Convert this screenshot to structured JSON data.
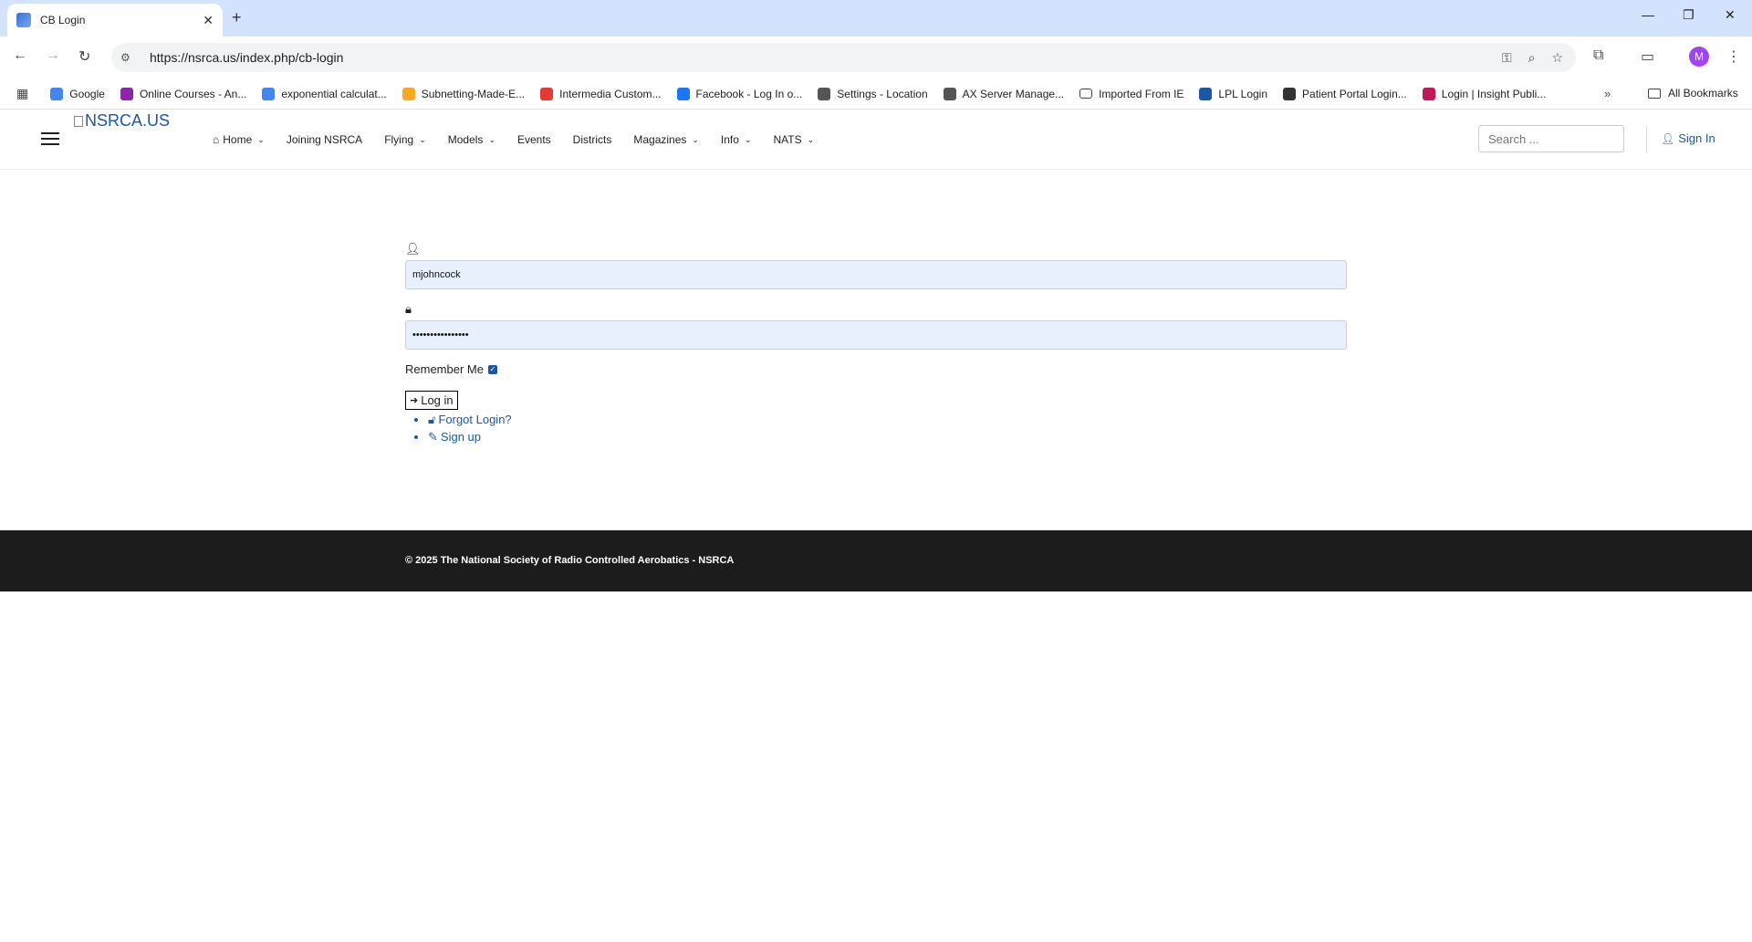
{
  "browser": {
    "tab_title": "CB Login",
    "url": "https://nsrca.us/index.php/cb-login",
    "profile_initial": "M",
    "bookmarks": [
      {
        "label": "Google",
        "color": "#4285f4"
      },
      {
        "label": "Online Courses - An...",
        "color": "#8e24aa"
      },
      {
        "label": "exponential calculat...",
        "color": "#4285f4"
      },
      {
        "label": "Subnetting-Made-E...",
        "color": "#f9a825"
      },
      {
        "label": "Intermedia Custom...",
        "color": "#e53935"
      },
      {
        "label": "Facebook - Log In o...",
        "color": "#1877f2"
      },
      {
        "label": "Settings - Location",
        "color": "#555555"
      },
      {
        "label": "AX Server Manage...",
        "color": "#555555"
      },
      {
        "label": "Imported From IE",
        "color": "#ffffff"
      },
      {
        "label": "LPL Login",
        "color": "#1a58a6"
      },
      {
        "label": "Patient Portal Login...",
        "color": "#333333"
      },
      {
        "label": "Login | Insight Publi...",
        "color": "#c2185b"
      }
    ],
    "all_bookmarks": "All Bookmarks"
  },
  "site": {
    "logo_alt": "NSRCA.US",
    "nav": [
      {
        "label": "Home",
        "has_menu": true,
        "icon": "home-icon"
      },
      {
        "label": "Joining NSRCA",
        "has_menu": false
      },
      {
        "label": "Flying",
        "has_menu": true
      },
      {
        "label": "Models",
        "has_menu": true
      },
      {
        "label": "Events",
        "has_menu": false
      },
      {
        "label": "Districts",
        "has_menu": false
      },
      {
        "label": "Magazines",
        "has_menu": true
      },
      {
        "label": "Info",
        "has_menu": true
      },
      {
        "label": "NATS",
        "has_menu": true
      }
    ],
    "search_placeholder": "Search ...",
    "sign_in": "Sign In"
  },
  "login": {
    "username_value": "mjohncock",
    "password_value": "••••••••••••••••",
    "remember_label": "Remember Me",
    "remember_checked": true,
    "login_button": "Log in",
    "forgot_link": "Forgot Login?",
    "signup_link": "Sign up"
  },
  "footer": {
    "copyright": "© 2025 The National Society of Radio Controlled Aerobatics - NSRCA"
  }
}
